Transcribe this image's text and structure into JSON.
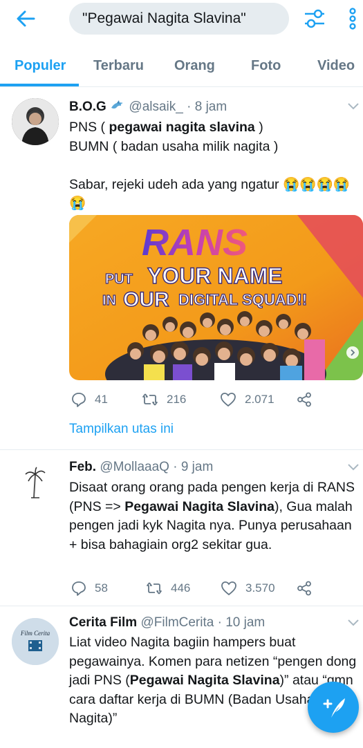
{
  "search": {
    "query": "\"Pegawai Nagita Slavina\""
  },
  "tabs": [
    {
      "label": "Populer"
    },
    {
      "label": "Terbaru"
    },
    {
      "label": "Orang"
    },
    {
      "label": "Foto"
    },
    {
      "label": "Video"
    }
  ],
  "tweets": [
    {
      "name": "B.O.G",
      "handle": "@alsaik_",
      "time": "· 8 jam",
      "line1_pre": "PNS ( ",
      "line1_bold": "pegawai nagita slavina",
      "line1_post": " )",
      "line2": "BUMN ( badan usaha milik nagita )",
      "line3": "Sabar, rejeki udeh ada yang ngatur",
      "emoji": "😭",
      "media": {
        "logo": "RANS",
        "line1_a": "PUT",
        "line1_b": "YOUR NAME",
        "line2_a": "IN",
        "line2_b": "OUR",
        "line2_c": "DIGITAL SQUAD!!"
      },
      "replies": "41",
      "retweets": "216",
      "likes": "2.071",
      "thread_label": "Tampilkan utas ini"
    },
    {
      "name": "Feb.",
      "handle": "@MollaaaQ",
      "time": "· 9 jam",
      "text_pre": "Disaat orang orang pada pengen kerja di RANS (PNS => ",
      "text_bold": "Pegawai Nagita Slavina",
      "text_post": "), Gua malah pengen jadi kyk Nagita nya. Punya perusahaan + bisa bahagiain org2 sekitar gua.",
      "replies": "58",
      "retweets": "446",
      "likes": "3.570"
    },
    {
      "name": "Cerita Film",
      "handle": "@FilmCerita",
      "time": "· 10 jam",
      "avatar_text": "Film Cerita",
      "text_pre": "Liat video Nagita bagiin hampers buat pegawainya. Komen para netizen “pengen dong jadi PNS (",
      "text_bold": "Pegawai Nagita Slavina",
      "text_post": ")” atau “gmn cara daftar kerja di BUMN (Badan Usaha Milik Nagita)”"
    }
  ],
  "colors": {
    "accent": "#1da1f2",
    "muted": "#657786",
    "text": "#14171a",
    "divider": "#e6ecf0"
  }
}
